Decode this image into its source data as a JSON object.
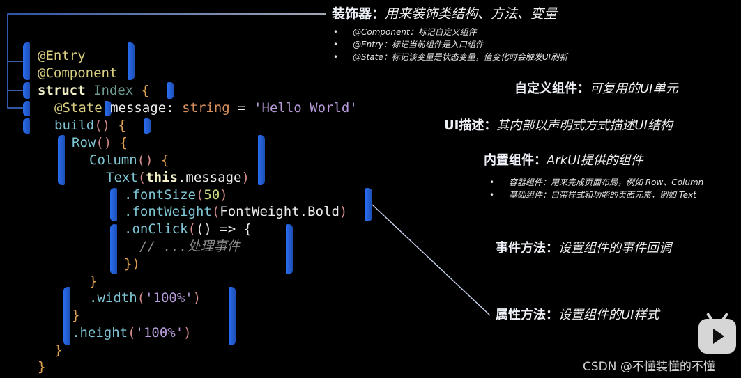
{
  "code": {
    "entry": "@Entry",
    "component": "@Component",
    "struct_kw": "struct",
    "struct_name": "Index",
    "open_brace": "{",
    "state_deco": "@State",
    "state_var": "message:",
    "state_type": "string",
    "state_eq": "=",
    "state_value": "'Hello World'",
    "build": "build",
    "parens": "()",
    "row": "Row",
    "column": "Column",
    "text": "Text",
    "text_arg_this": "this",
    "text_arg_rest": ".message",
    "font_size_method": ".fontSize",
    "font_size_value": "50",
    "font_weight_method": ".fontWeight",
    "font_weight_value": "FontWeight.Bold",
    "on_click_method": ".onClick",
    "on_click_arrow": "() => {",
    "comment": "// ...处理事件",
    "close_onclick": "})",
    "close_brace": "}",
    "width_method": ".width",
    "width_value": "'100%'",
    "height_method": ".height",
    "height_value": "'100%'"
  },
  "annotations": {
    "decorator": {
      "title": "装饰器：",
      "desc": "用来装饰类结构、方法、变量",
      "bullets": [
        "@Component：标记自定义组件",
        "@Entry：标记当前组件是入口组件",
        "@State：标记该变量是状态变量，值变化时会触发UI刷新"
      ]
    },
    "custom_component": {
      "title": "自定义组件：",
      "desc": "可复用的UI单元"
    },
    "ui_description": {
      "title": "UI描述：",
      "desc": "其内部以声明式方式描述UI结构"
    },
    "builtin_component": {
      "title": "内置组件：",
      "desc": "ArkUI提供的组件",
      "bullets": [
        "容器组件：用来完成页面布局，例如 Row、Column",
        "基础组件：自带样式和功能的页面元素，例如 Text"
      ]
    },
    "event_method": {
      "title": "事件方法：",
      "desc": "设置组件的事件回调"
    },
    "attribute_method": {
      "title": "属性方法：",
      "desc": "设置组件的UI样式"
    }
  },
  "bullet_char": "•",
  "watermark": "CSDN @不懂装懂的不懂",
  "icons": {
    "bilibili": "bilibili-tv-icon"
  },
  "colors": {
    "bracket": "#2a6df0",
    "wire": "#6a8fe0",
    "background": "#000000"
  }
}
